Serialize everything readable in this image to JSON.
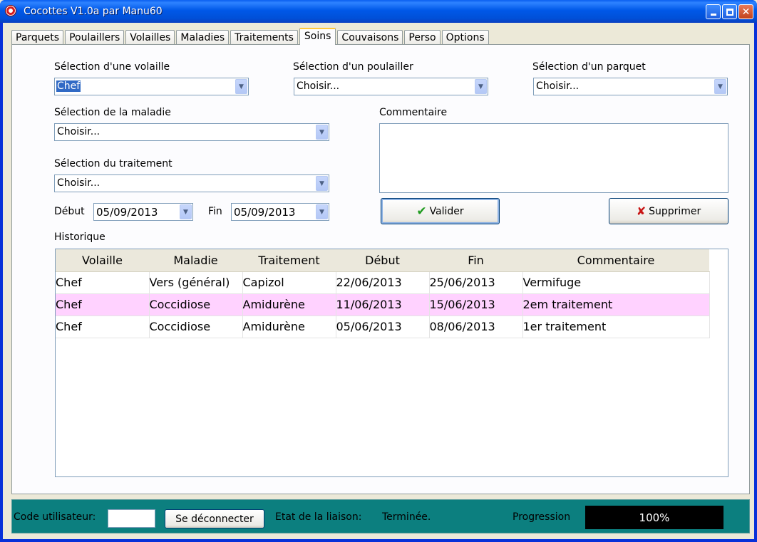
{
  "window": {
    "title": "Cocottes V1.0a par Manu60",
    "minimize_label": "_",
    "maximize_label": "□",
    "close_label": "✕"
  },
  "tabs": [
    {
      "label": "Parquets"
    },
    {
      "label": "Poulaillers"
    },
    {
      "label": "Volailles"
    },
    {
      "label": "Maladies"
    },
    {
      "label": "Traitements"
    },
    {
      "label": "Soins",
      "active": true
    },
    {
      "label": "Couvaisons"
    },
    {
      "label": "Perso"
    },
    {
      "label": "Options"
    }
  ],
  "form": {
    "volaille": {
      "label": "Sélection d'une volaille",
      "value": "Chef"
    },
    "poulailler": {
      "label": "Sélection d'un poulailler",
      "value": "Choisir..."
    },
    "parquet": {
      "label": "Sélection d'un parquet",
      "value": "Choisir..."
    },
    "maladie": {
      "label": "Sélection de la maladie",
      "value": "Choisir..."
    },
    "traitement": {
      "label": "Sélection du traitement",
      "value": "Choisir..."
    },
    "commentaire": {
      "label": "Commentaire",
      "value": ""
    },
    "debut": {
      "label": "Début",
      "value": "05/09/2013"
    },
    "fin": {
      "label": "Fin",
      "value": "05/09/2013"
    },
    "valider_label": "Valider",
    "supprimer_label": "Supprimer"
  },
  "historique": {
    "label": "Historique",
    "columns": [
      "Volaille",
      "Maladie",
      "Traitement",
      "Début",
      "Fin",
      "Commentaire"
    ],
    "rows": [
      [
        "Chef",
        "Vers (général)",
        "Capizol",
        "22/06/2013",
        "25/06/2013",
        "Vermifuge"
      ],
      [
        "Chef",
        "Coccidiose",
        "Amidurène",
        "11/06/2013",
        "15/06/2013",
        "2em traitement"
      ],
      [
        "Chef",
        "Coccidiose",
        "Amidurène",
        "05/06/2013",
        "08/06/2013",
        "1er traitement"
      ]
    ],
    "highlight_color": "#ffd2ff"
  },
  "status": {
    "user_code_label": "Code utilisateur:",
    "user_code_value": "",
    "disconnect_label": "Se déconnecter",
    "link_state_label": "Etat de la liaison:",
    "link_state_value": "Terminée.",
    "progress_label": "Progression",
    "progress_value": "100%",
    "bar_color": "#0c7f7f"
  }
}
